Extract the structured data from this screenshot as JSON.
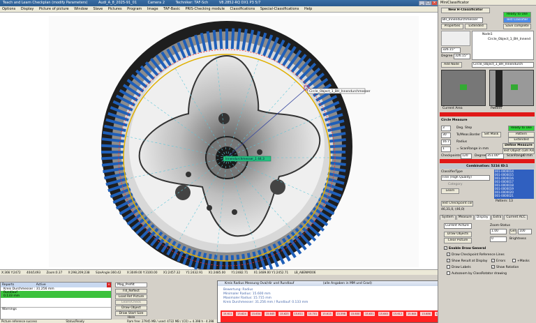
{
  "window": {
    "titles": [
      "Teach and Learn Checkplan (modify Parameters)",
      "Audi_A_8_2025-91_01",
      "Camera 2",
      "Techniker: TAF-Sch",
      "V8.2852-RQ DX1 P3 5/7"
    ],
    "controls": [
      "_",
      "□",
      "×"
    ]
  },
  "menu": {
    "items": [
      "Options",
      "Display",
      "Picture of picture",
      "Window",
      "Slave",
      "Pictures",
      "Program",
      "Image",
      "TAF-Basic",
      "PRIS-Checking module",
      "Classifications",
      "Special-Classifications",
      "Help"
    ]
  },
  "overlay": {
    "diameter_label": "Circle_Object_1_BH_Innendurchmesser",
    "center_label": "Innendurchmesser_1 44.3"
  },
  "status_strip": {
    "items": [
      "X:366  Y:2472",
      "404/1493",
      "Zoom:0.37",
      "X:298,209;238",
      "SizeAngle:360.42",
      "X:3049.00  Y:3100.00",
      "X1:2457.32",
      "Y1:2432.91",
      "X1:2485.00",
      "Y1:2482.71",
      "X1:3489.00  Y1:2452.71",
      "LB_A8ENMO06"
    ]
  },
  "report": {
    "tabs": [
      "Reports",
      "Active"
    ],
    "rows": [
      "Kreis Durchmesser : 31.256 mm",
      "Rundlauf",
      "    0.133 mm"
    ],
    "warnings_label": "Warnings"
  },
  "mid_panel": {
    "dropdown": "Mag_Prefilt",
    "buttons": [
      "Fill_Reflect",
      "Load Ref Picture",
      "Learn/Check",
      "Draw Object",
      "Draw Start Size Here"
    ]
  },
  "graph": {
    "title": "Kreis Radius Messung Oval/dir und Rundlauf",
    "subtitle": "(alle Angaben in MM und Grad)",
    "value_box": "0.97",
    "lines": [
      "Bewertung: Radius",
      "Minimaler Radius: 15.600 mm",
      "Maximaler Radius: 15.715 mm",
      "Kreis Durchmesser: 31.256 mm / Rundlauf: 0.133 mm"
    ],
    "bar_labels": [
      "15.611",
      "15.624",
      "15.634",
      "15.645",
      "15.625",
      "15.611",
      "15.701",
      "15.613",
      "15.598",
      "15.600",
      "15.631",
      "15.640",
      "15.612",
      "15.644",
      "15.686",
      "15.671",
      "15.615",
      "15.631",
      "15.650",
      "15.677",
      "15.683",
      "15.640"
    ]
  },
  "bottom_status": {
    "left": "Picture reference success",
    "middle": "Status/Ready",
    "right": "Ram free: 27945 MB / used: 4722 MB / (CO) = 4.398 h - 4.398"
  },
  "right_panel": {
    "title": "MiniClassificator",
    "new_classifier": "New H-Classificator",
    "ready": "Ready to Use",
    "test_classifier": "Test Classifier",
    "classifier_name": "BH_Innendurchmesser",
    "properties": "Properties",
    "extended": "Extended",
    "save_complete": "Save complete",
    "tree_root": "Node1",
    "tree_child": "Circle_Object_1_BH_Innend",
    "coord1": "326.15°",
    "coord2": "326.15°",
    "degree_label": "Degree",
    "add_node": "Add Node",
    "node_path": "Circle_Object_1_BH_Innendurch",
    "thumb1_label": "Current Area",
    "thumb2_label": "Pattern",
    "circle_measure": "Circle Measure",
    "deg_step_label": "Deg. Step",
    "deg_step": "3",
    "ts_border_label": "Ts/Meas.Border",
    "ts_border": "30",
    "radius_label": "Radius",
    "radius": "16.7",
    "scan_range_label": "= ScanRange in mm",
    "scan_range": "1",
    "checkpoints_label": "Checkpoints",
    "checkpoints": "120",
    "degree2_label": "Degree",
    "degree2": "351.00°",
    "ready2": "Ready to Use",
    "set_mask": "Set Mask",
    "pattern_btn": "Pattern",
    "extended2": "Extended",
    "define_measure": "Define Measure",
    "test_object": "Test Object cum Area",
    "scan_range2_label": "ScanRange",
    "scan_range2": "0 mm",
    "combination": "Combination: 5216 ID:1",
    "classifier_type_label": "ClassifierType",
    "classifier_type": "Fine (High Quality)",
    "category_label": "Category",
    "learn": "Learn",
    "list_items": [
      "001-0000014",
      "001-0000015",
      "001-0000016",
      "001-0000017",
      "001-0000018",
      "001-0000019",
      "001-0000020",
      "001-0000021"
    ],
    "pattern_count": "Pattern: 13",
    "test_checkpoint": "Test Checkpoint complet",
    "stats": "46,31,0, (46,0)",
    "tabs": [
      "System",
      "Measure",
      "Display",
      "Extra",
      "Current ACC"
    ],
    "current_picture": "Current Picture",
    "zoom_status": "Zoom-Status",
    "zoom_value": "1.00",
    "draw_objects": "Draw Objects",
    "clear_picture": "Clear Picture",
    "gel_label": "Gel",
    "gel_value": "100",
    "brightness_label": "Brightness",
    "brightness": "0",
    "enable_draw": "Enable Draw General",
    "checks": [
      "Draw Checkpoint Reference Lines",
      "Show Result at Display",
      "Draw Labels",
      "Autozoom by ClassRotator drawing"
    ],
    "checks_right": [
      "Errors",
      "+Masks",
      "Show Rotation"
    ]
  },
  "colors": {
    "bars": "#1f5fb8",
    "gold_circle": "#e0b000",
    "red_scan": "#ff2a2a",
    "dashed": "#5fc6d8",
    "green_center": "#1fb83a"
  }
}
